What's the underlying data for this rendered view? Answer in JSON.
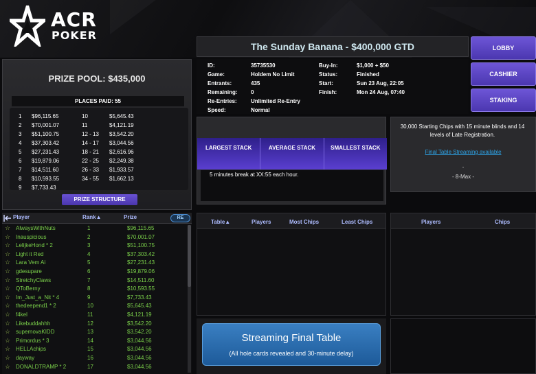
{
  "brand": {
    "line1": "ACR",
    "line2": "POKER"
  },
  "tournament": {
    "title": "The Sunday Banana - $400,000 GTD"
  },
  "nav": {
    "lobby": "LOBBY",
    "cashier": "CASHIER",
    "staking": "STAKING"
  },
  "info": {
    "left": [
      {
        "label": "ID:",
        "value": "35735530"
      },
      {
        "label": "Game:",
        "value": "Holdem No Limit"
      },
      {
        "label": "Entrants:",
        "value": "435"
      },
      {
        "label": "Remaining:",
        "value": "0"
      },
      {
        "label": "Re-Entries:",
        "value": "Unlimited Re-Entry"
      },
      {
        "label": "Speed:",
        "value": "Normal"
      }
    ],
    "right": [
      {
        "label": "Buy-In:",
        "value": "$1,000 + $50"
      },
      {
        "label": "Status:",
        "value": "Finished"
      },
      {
        "label": "Start:",
        "value": "Sun 23 Aug, 22:05"
      },
      {
        "label": "Finish:",
        "value": "Mon 24 Aug, 07:40"
      }
    ]
  },
  "prize": {
    "pool_label": "PRIZE POOL: $435,000",
    "places_paid": "PLACES PAID: 55",
    "structure_button": "PRIZE STRUCTURE",
    "left_col": [
      {
        "place": "1",
        "amount": "$96,115.65"
      },
      {
        "place": "2",
        "amount": "$70,001.07"
      },
      {
        "place": "3",
        "amount": "$51,100.75"
      },
      {
        "place": "4",
        "amount": "$37,303.42"
      },
      {
        "place": "5",
        "amount": "$27,231.43"
      },
      {
        "place": "6",
        "amount": "$19,879.06"
      },
      {
        "place": "7",
        "amount": "$14,511.60"
      },
      {
        "place": "8",
        "amount": "$10,593.55"
      },
      {
        "place": "9",
        "amount": "$7,733.43"
      }
    ],
    "right_col": [
      {
        "place": "10",
        "amount": "$5,645.43"
      },
      {
        "place": "11",
        "amount": "$4,121.19"
      },
      {
        "place": "12 - 13",
        "amount": "$3,542.20"
      },
      {
        "place": "14 - 17",
        "amount": "$3,044.56"
      },
      {
        "place": "18 - 21",
        "amount": "$2,616.96"
      },
      {
        "place": "22 - 25",
        "amount": "$2,249.38"
      },
      {
        "place": "26 - 33",
        "amount": "$1,933.57"
      },
      {
        "place": "34 - 55",
        "amount": "$1,662.13"
      }
    ]
  },
  "stacks": {
    "tabs": [
      "LARGEST STACK",
      "AVERAGE STACK",
      "SMALLEST STACK"
    ],
    "break_text": "5 minutes break at XX:55 each hour."
  },
  "description": {
    "text": "30,000 Starting Chips with 15 minute blinds and 14 levels of Late Registration.",
    "link": "Final Table Streaming available",
    "dash": "-",
    "max": "- 8-Max -"
  },
  "players": {
    "headers": {
      "player": "Player",
      "rank": "Rank▲",
      "prize": "Prize"
    },
    "re_badge": "RE",
    "rows": [
      {
        "name": "AlwaysWithNuts",
        "rank": "1",
        "prize": "$96,115.65"
      },
      {
        "name": "Inauspicious",
        "rank": "2",
        "prize": "$70,001.07"
      },
      {
        "name": "LelijkeHond * 2",
        "rank": "3",
        "prize": "$51,100.75"
      },
      {
        "name": "Light it Red",
        "rank": "4",
        "prize": "$37,303.42"
      },
      {
        "name": "Lara Vem Ai",
        "rank": "5",
        "prize": "$27,231.43"
      },
      {
        "name": "gdesupare",
        "rank": "6",
        "prize": "$19,879.06"
      },
      {
        "name": "StretchyClaws",
        "rank": "7",
        "prize": "$14,511.60"
      },
      {
        "name": "QToBerny",
        "rank": "8",
        "prize": "$10,593.55"
      },
      {
        "name": "Im_Just_a_Nit * 4",
        "rank": "9",
        "prize": "$7,733.43"
      },
      {
        "name": "thedeepend1 * 2",
        "rank": "10",
        "prize": "$5,645.43"
      },
      {
        "name": "f4kel",
        "rank": "11",
        "prize": "$4,121.19"
      },
      {
        "name": "Likebuddahhh",
        "rank": "12",
        "prize": "$3,542.20"
      },
      {
        "name": "supernovaKIDD",
        "rank": "13",
        "prize": "$3,542.20"
      },
      {
        "name": "Primordus * 3",
        "rank": "14",
        "prize": "$3,044.56"
      },
      {
        "name": "HELLAchips",
        "rank": "15",
        "prize": "$3,044.56"
      },
      {
        "name": "dayway",
        "rank": "16",
        "prize": "$3,044.56"
      },
      {
        "name": "DONALDTRAMP * 2",
        "rank": "17",
        "prize": "$3,044.56"
      }
    ]
  },
  "tables": {
    "headers": [
      "Table▲",
      "Players",
      "Most Chips",
      "Least Chips"
    ]
  },
  "chips": {
    "headers": [
      "Players",
      "Chips"
    ]
  },
  "stream": {
    "title": "Streaming Final Table",
    "subtitle": "(All hole cards revealed and 30-minute delay)"
  },
  "colors": {
    "accent_purple": "#5a41c6",
    "player_green": "#7bd14a",
    "header_blue": "#aebcff",
    "stream_blue": "#2a6cad"
  }
}
